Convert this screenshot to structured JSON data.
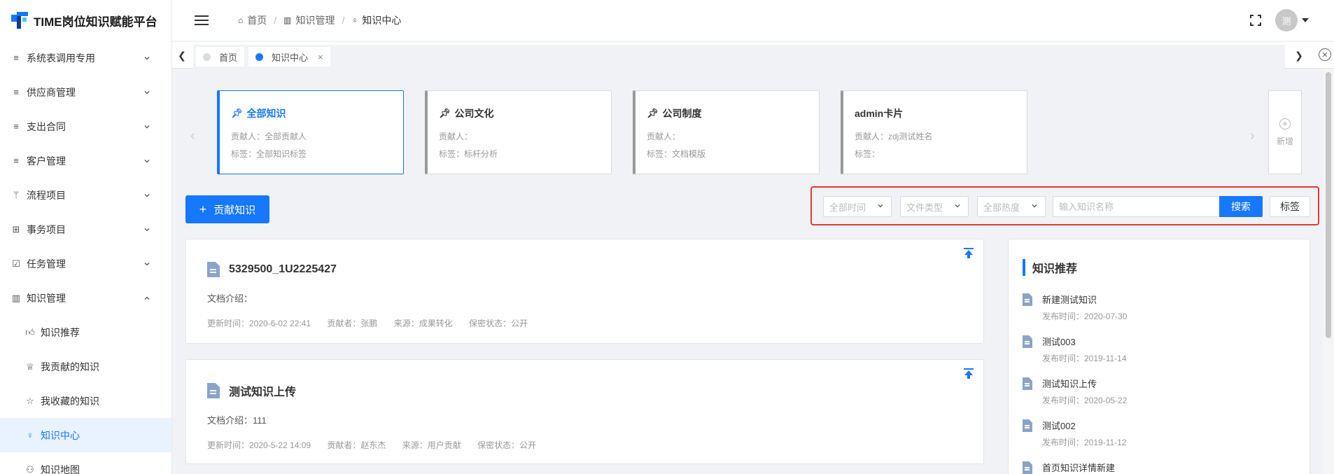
{
  "app": {
    "title": "TIME岗位知识赋能平台"
  },
  "colors": {
    "primary": "#1677ff",
    "highlight_border": "#e53935"
  },
  "sidebar": {
    "items": [
      {
        "label": "系统表调用专用",
        "icon": "menu-lines-icon"
      },
      {
        "label": "供应商管理",
        "icon": "menu-lines-icon"
      },
      {
        "label": "支出合同",
        "icon": "menu-lines-icon"
      },
      {
        "label": "客户管理",
        "icon": "menu-lines-icon"
      },
      {
        "label": "流程项目",
        "icon": "branch-icon"
      },
      {
        "label": "事务项目",
        "icon": "grid-icon"
      },
      {
        "label": "任务管理",
        "icon": "checkbox-icon"
      },
      {
        "label": "知识管理",
        "icon": "book-icon",
        "expanded": true
      }
    ],
    "subitems": [
      {
        "label": "知识推荐",
        "icon": "thumbs-up-icon"
      },
      {
        "label": "我贡献的知识",
        "icon": "trophy-icon"
      },
      {
        "label": "我收藏的知识",
        "icon": "star-icon"
      },
      {
        "label": "知识中心",
        "icon": "bulb-icon",
        "active": true
      },
      {
        "label": "知识地图",
        "icon": "sitemap-icon"
      }
    ]
  },
  "header": {
    "breadcrumb": [
      {
        "label": "首页",
        "icon": "home-icon"
      },
      {
        "label": "知识管理",
        "icon": "book-icon"
      },
      {
        "label": "知识中心",
        "icon": "bulb-icon"
      }
    ],
    "user": {
      "avatar_text": "测"
    }
  },
  "tabs": [
    {
      "label": "首页",
      "active": false
    },
    {
      "label": "知识中心",
      "active": true,
      "close": "×"
    }
  ],
  "cards": [
    {
      "title": "全部知识",
      "contributor": "贡献人：全部贡献人",
      "tags": "标签：全部知识标签",
      "pinned": true,
      "active": true
    },
    {
      "title": "公司文化",
      "contributor": "贡献人：",
      "tags": "标签：标杆分析",
      "pinned": true
    },
    {
      "title": "公司制度",
      "contributor": "贡献人：",
      "tags": "标签：文档模版",
      "pinned": true
    },
    {
      "title": "admin卡片",
      "contributor": "贡献人：zdj测试姓名",
      "tags": "标签：",
      "pinned": false
    }
  ],
  "add_card": {
    "label": "新增"
  },
  "toolbar": {
    "contribute_label": "贡献知识",
    "time_filter": "全部时间",
    "type_filter": "文件类型",
    "heat_filter": "全部热度",
    "search_placeholder": "输入知识名称",
    "search_label": "搜索",
    "tag_label": "标签"
  },
  "documents": [
    {
      "title": "5329500_1U2225427",
      "intro": "文档介绍：",
      "updated": "更新时间：2020-6-02 22:41",
      "contributor": "贡献者：张鹏",
      "source": "来源：成果转化",
      "secrecy": "保密状态：公开"
    },
    {
      "title": "测试知识上传",
      "intro": "文档介绍：111",
      "updated": "更新时间：2020-5-22 14:09",
      "contributor": "贡献者：赵东杰",
      "source": "来源：用户贡献",
      "secrecy": "保密状态：公开"
    }
  ],
  "recommend": {
    "title": "知识推荐",
    "items": [
      {
        "name": "新建测试知识",
        "date": "发布时间：2020-07-30"
      },
      {
        "name": "测试003",
        "date": "发布时间：2019-11-14"
      },
      {
        "name": "测试知识上传",
        "date": "发布时间：2020-05-22"
      },
      {
        "name": "测试002",
        "date": "发布时间：2019-11-12"
      },
      {
        "name": "首页知识详情新建",
        "date": ""
      }
    ]
  }
}
